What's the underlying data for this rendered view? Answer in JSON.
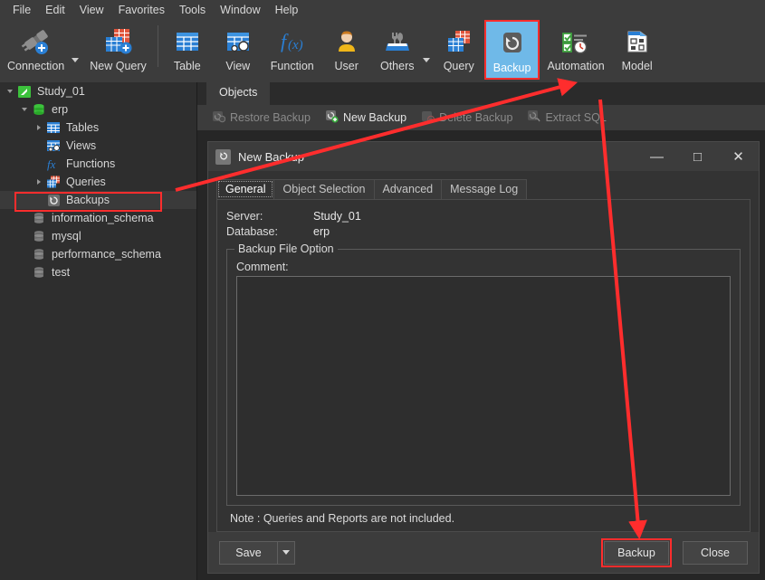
{
  "menubar": {
    "items": [
      {
        "label": "File"
      },
      {
        "label": "Edit"
      },
      {
        "label": "View"
      },
      {
        "label": "Favorites"
      },
      {
        "label": "Tools"
      },
      {
        "label": "Window"
      },
      {
        "label": "Help"
      }
    ]
  },
  "toolbar": {
    "items": [
      {
        "label": "Connection",
        "icon": "connection-icon",
        "caret": true,
        "selected": false
      },
      {
        "label": "New Query",
        "icon": "new-query-icon",
        "caret": false,
        "selected": false
      },
      {
        "label": "Table",
        "icon": "table-icon",
        "caret": false,
        "selected": false
      },
      {
        "label": "View",
        "icon": "view-icon",
        "caret": false,
        "selected": false
      },
      {
        "label": "Function",
        "icon": "function-icon",
        "caret": false,
        "selected": false
      },
      {
        "label": "User",
        "icon": "user-icon",
        "caret": false,
        "selected": false
      },
      {
        "label": "Others",
        "icon": "others-icon",
        "caret": true,
        "selected": false
      },
      {
        "label": "Query",
        "icon": "query-icon",
        "caret": false,
        "selected": false
      },
      {
        "label": "Backup",
        "icon": "backup-icon",
        "caret": false,
        "selected": true
      },
      {
        "label": "Automation",
        "icon": "automation-icon",
        "caret": false,
        "selected": false
      },
      {
        "label": "Model",
        "icon": "model-icon",
        "caret": false,
        "selected": false
      }
    ]
  },
  "sidebar": {
    "items": [
      {
        "label": "Study_01",
        "icon": "connection-node-icon",
        "indent": 0,
        "twisty": "expanded",
        "selected": false
      },
      {
        "label": "erp",
        "icon": "database-open-icon",
        "indent": 1,
        "twisty": "expanded",
        "selected": false
      },
      {
        "label": "Tables",
        "icon": "tables-icon",
        "indent": 2,
        "twisty": "collapsed",
        "selected": false
      },
      {
        "label": "Views",
        "icon": "views-icon",
        "indent": 2,
        "twisty": "none",
        "selected": false
      },
      {
        "label": "Functions",
        "icon": "functions-icon",
        "indent": 2,
        "twisty": "none",
        "selected": false
      },
      {
        "label": "Queries",
        "icon": "queries-icon",
        "indent": 2,
        "twisty": "collapsed",
        "selected": false
      },
      {
        "label": "Backups",
        "icon": "backups-icon",
        "indent": 2,
        "twisty": "none",
        "selected": true
      },
      {
        "label": "information_schema",
        "icon": "database-icon",
        "indent": 1,
        "twisty": "none",
        "selected": false
      },
      {
        "label": "mysql",
        "icon": "database-icon",
        "indent": 1,
        "twisty": "none",
        "selected": false
      },
      {
        "label": "performance_schema",
        "icon": "database-icon",
        "indent": 1,
        "twisty": "none",
        "selected": false
      },
      {
        "label": "test",
        "icon": "database-icon",
        "indent": 1,
        "twisty": "none",
        "selected": false
      }
    ]
  },
  "main": {
    "tab_label": "Objects",
    "object_toolbar": [
      {
        "label": "Restore Backup",
        "icon": "restore-backup-icon",
        "enabled": false
      },
      {
        "label": "New Backup",
        "icon": "new-backup-icon",
        "enabled": true
      },
      {
        "label": "Delete Backup",
        "icon": "delete-backup-icon",
        "enabled": false
      },
      {
        "label": "Extract SQL",
        "icon": "extract-sql-icon",
        "enabled": false
      }
    ]
  },
  "dialog": {
    "title": "New Backup",
    "title_icon": "backup-icon",
    "window_controls": {
      "minimize": "—",
      "maximize": "□",
      "close": "✕"
    },
    "tabs": [
      {
        "label": "General",
        "active": true
      },
      {
        "label": "Object Selection",
        "active": false
      },
      {
        "label": "Advanced",
        "active": false
      },
      {
        "label": "Message Log",
        "active": false
      }
    ],
    "fields": {
      "server_label": "Server:",
      "server_value": "Study_01",
      "database_label": "Database:",
      "database_value": "erp"
    },
    "group": {
      "title": "Backup File Option",
      "comment_label": "Comment:",
      "comment_value": "",
      "comment_placeholder": ""
    },
    "note": "Note : Queries and Reports are not included.",
    "footer": {
      "save_label": "Save",
      "backup_label": "Backup",
      "close_label": "Close"
    }
  },
  "annotations": {
    "highlight_color": "#ff2d2d",
    "arrow1_name": "arrow-backups-to-backup-toolbar",
    "arrow2_name": "arrow-backup-toolbar-to-backup-button"
  }
}
